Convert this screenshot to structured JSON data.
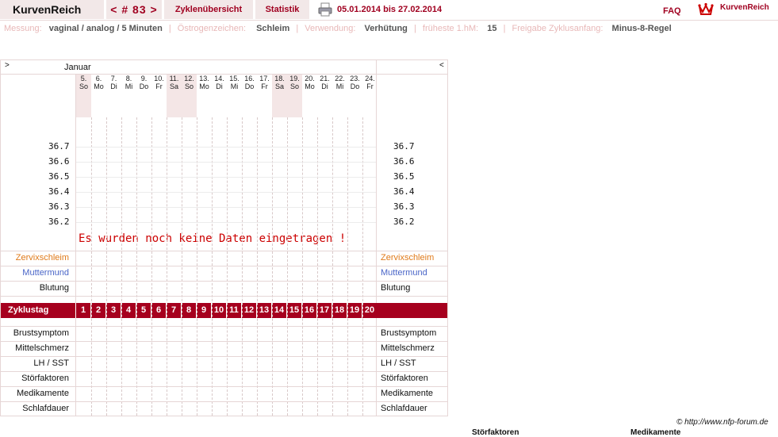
{
  "topbar": {
    "brand": "KurvenReich",
    "cycle_nav": "< # 83 >",
    "tab_overview": "Zyklenübersicht",
    "tab_stats": "Statistik",
    "date_range": "05.01.2014 bis 27.02.2014",
    "faq": "FAQ",
    "logo_text": "KurvenReich"
  },
  "info": {
    "messung_label": "Messung:",
    "messung_value": "vaginal / analog / 5 Minuten",
    "oestrogen_label": "Östrogenzeichen:",
    "oestrogen_value": "Schleim",
    "verwendung_label": "Verwendung:",
    "verwendung_value": "Verhütung",
    "hm_label": "früheste 1.hM:",
    "hm_value": "15",
    "freigabe_label": "Freigabe Zyklusanfang:",
    "freigabe_value": "Minus-8-Regel"
  },
  "chart": {
    "nav_left": ">",
    "nav_right": "<",
    "month": "Januar",
    "days": [
      {
        "d": "5.",
        "w": "So",
        "weekend": true
      },
      {
        "d": "6.",
        "w": "Mo",
        "weekend": false
      },
      {
        "d": "7.",
        "w": "Di",
        "weekend": false
      },
      {
        "d": "8.",
        "w": "Mi",
        "weekend": false
      },
      {
        "d": "9.",
        "w": "Do",
        "weekend": false
      },
      {
        "d": "10.",
        "w": "Fr",
        "weekend": false
      },
      {
        "d": "11.",
        "w": "Sa",
        "weekend": true
      },
      {
        "d": "12.",
        "w": "So",
        "weekend": true
      },
      {
        "d": "13.",
        "w": "Mo",
        "weekend": false
      },
      {
        "d": "14.",
        "w": "Di",
        "weekend": false
      },
      {
        "d": "15.",
        "w": "Mi",
        "weekend": false
      },
      {
        "d": "16.",
        "w": "Do",
        "weekend": false
      },
      {
        "d": "17.",
        "w": "Fr",
        "weekend": false
      },
      {
        "d": "18.",
        "w": "Sa",
        "weekend": true
      },
      {
        "d": "19.",
        "w": "So",
        "weekend": true
      },
      {
        "d": "20.",
        "w": "Mo",
        "weekend": false
      },
      {
        "d": "21.",
        "w": "Di",
        "weekend": false
      },
      {
        "d": "22.",
        "w": "Mi",
        "weekend": false
      },
      {
        "d": "23.",
        "w": "Do",
        "weekend": false
      },
      {
        "d": "24.",
        "w": "Fr",
        "weekend": false
      }
    ],
    "temps": [
      "36.7",
      "36.6",
      "36.5",
      "36.4",
      "36.3",
      "36.2"
    ],
    "no_data": "Es wurden noch keine Daten eingetragen !",
    "upper_rows": [
      {
        "label": "Zervixschleim",
        "color": "#e07a1a"
      },
      {
        "label": "Muttermund",
        "color": "#4a66c8"
      },
      {
        "label": "Blutung",
        "color": "#111111"
      }
    ],
    "cycle_label": "Zyklustag",
    "cycle_days": [
      "1",
      "2",
      "3",
      "4",
      "5",
      "6",
      "7",
      "8",
      "9",
      "10",
      "11",
      "12",
      "13",
      "14",
      "15",
      "16",
      "17",
      "18",
      "19",
      "20"
    ],
    "lower_rows": [
      "Brustsymptom",
      "Mittelschmerz",
      "LH / SST",
      "Störfaktoren",
      "Medikamente",
      "Schlafdauer"
    ]
  },
  "footer": {
    "copyright": "© http://www.nfp-forum.de",
    "cut_left": "Störfaktoren",
    "cut_right": "Medikamente"
  },
  "colors": {
    "accent": "#a6001e",
    "tab_bg": "#f2e8e8"
  }
}
